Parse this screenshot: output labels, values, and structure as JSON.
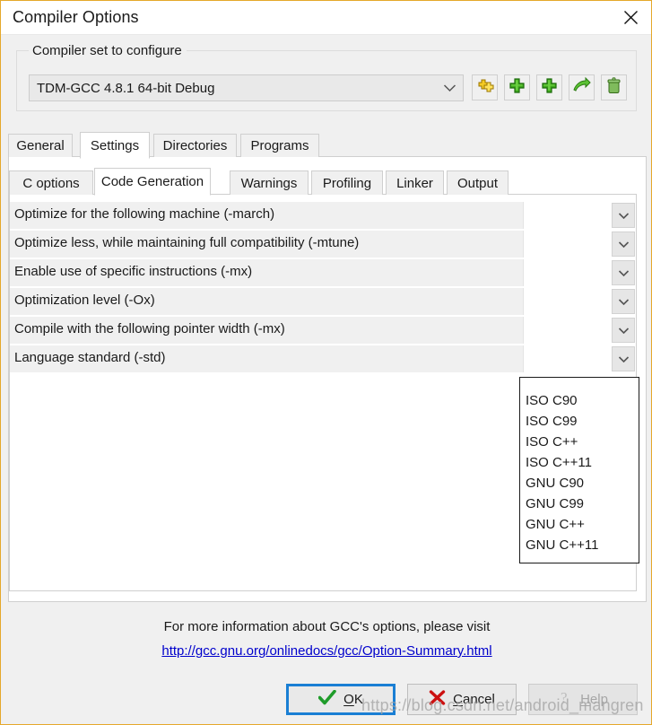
{
  "window": {
    "title": "Compiler Options",
    "close_icon": "close-icon",
    "border_color": "#e5a82b"
  },
  "compiler_set": {
    "group_label": "Compiler set to configure",
    "selected": "TDM-GCC 4.8.1 64-bit Debug",
    "dropdown_icon": "chevron-down-icon",
    "tools": [
      {
        "name": "configure-compiler-set-button",
        "icon": "yellow-double-plus-icon",
        "color": "#f2c218"
      },
      {
        "name": "add-compiler-set-button",
        "icon": "green-plus-icon",
        "color": "#4caf22"
      },
      {
        "name": "duplicate-compiler-set-button",
        "icon": "green-plus-icon",
        "color": "#4caf22"
      },
      {
        "name": "rename-compiler-set-button",
        "icon": "green-arrow-icon",
        "color": "#4caf22"
      },
      {
        "name": "delete-compiler-set-button",
        "icon": "green-trash-icon",
        "color": "#6fae4e"
      }
    ]
  },
  "outer_tabs": [
    {
      "label": "General",
      "active": false
    },
    {
      "label": "Settings",
      "active": true
    },
    {
      "label": "Directories",
      "active": false
    },
    {
      "label": "Programs",
      "active": false
    }
  ],
  "inner_tabs": [
    {
      "label": "C options",
      "active": false
    },
    {
      "label": "Code Generation",
      "active": true
    },
    {
      "label": "Warnings",
      "active": false
    },
    {
      "label": "Profiling",
      "active": false
    },
    {
      "label": "Linker",
      "active": false
    },
    {
      "label": "Output",
      "active": false
    }
  ],
  "options": [
    {
      "label": "Optimize for the following machine (-march)",
      "value": "",
      "editing": false
    },
    {
      "label": "Optimize less, while maintaining full compatibility (-mtune)",
      "value": "",
      "editing": false
    },
    {
      "label": "Enable use of specific instructions (-mx)",
      "value": "",
      "editing": false
    },
    {
      "label": "Optimization level (-Ox)",
      "value": "",
      "editing": false
    },
    {
      "label": "Compile with the following pointer width (-mx)",
      "value": "",
      "editing": false
    },
    {
      "label": "Language standard (-std)",
      "value": "",
      "editing": true
    }
  ],
  "dropdown": {
    "open": true,
    "owner": "Language standard (-std)",
    "items": [
      "ISO C90",
      "ISO C99",
      "ISO C++",
      "ISO C++11",
      "GNU C90",
      "GNU C99",
      "GNU C++",
      "GNU C++11"
    ]
  },
  "footer": {
    "text": "For more information about GCC's options, please visit",
    "link_text": "http://gcc.gnu.org/onlinedocs/gcc/Option-Summary.html",
    "link_color": "#0000cc"
  },
  "buttons": {
    "ok": {
      "label": "OK",
      "accel": "O",
      "icon": "green-check-icon",
      "focused": true,
      "disabled": false
    },
    "cancel": {
      "label": "Cancel",
      "accel": "C",
      "icon": "red-x-icon",
      "focused": false,
      "disabled": false
    },
    "help": {
      "label": "Help",
      "accel": "H",
      "icon": "question-mark-icon",
      "focused": false,
      "disabled": true
    }
  },
  "watermark": "https://blog.csdn.net/android_mangren"
}
